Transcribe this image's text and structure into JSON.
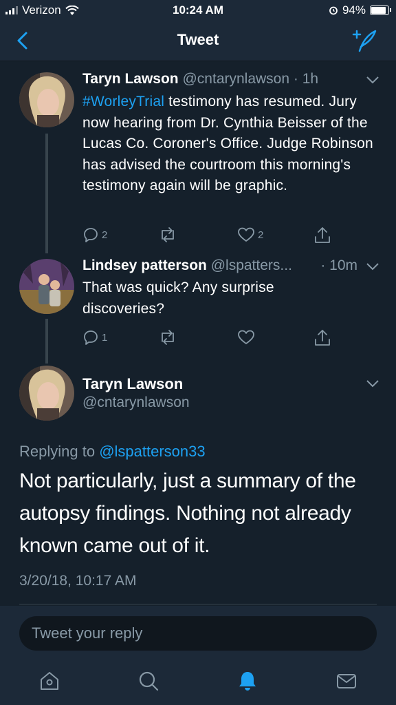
{
  "status_bar": {
    "carrier": "Verizon",
    "time": "10:24 AM",
    "battery": "94%",
    "battery_level": 0.94
  },
  "nav": {
    "title": "Tweet"
  },
  "thread": [
    {
      "name": "Taryn Lawson",
      "handle": "@cntarynlawson",
      "time": "· 1h",
      "hashtag": "#WorleyTrial",
      "text_after_hashtag": " testimony has resumed. Jury now hearing from Dr. Cynthia Beisser of the Lucas Co. Coroner's Office. Judge Robinson has advised the courtroom this morning's testimony again will be graphic.",
      "reply_count": "2",
      "retweet_count": "",
      "like_count": "2"
    },
    {
      "name": "Lindsey patterson",
      "handle": "@lspatters...",
      "time": "· 10m",
      "text": "That was quick? Any surprise discoveries?",
      "reply_count": "1",
      "retweet_count": "",
      "like_count": ""
    }
  ],
  "main_tweet": {
    "name": "Taryn Lawson",
    "handle": "@cntarynlawson",
    "replying_prefix": "Replying to ",
    "replying_to": "@lspatterson33",
    "text": "Not particularly, just a summary of the autopsy findings. Nothing not already known came out of it.",
    "timestamp": "3/20/18, 10:17 AM"
  },
  "reply": {
    "placeholder": "Tweet your reply"
  },
  "colors": {
    "background": "#15202b",
    "bar": "#1c2938",
    "accent": "#1da1f2",
    "muted": "#8899a6"
  },
  "tab_icons": [
    "home-icon",
    "search-icon",
    "notifications-bell-icon",
    "messages-icon"
  ]
}
